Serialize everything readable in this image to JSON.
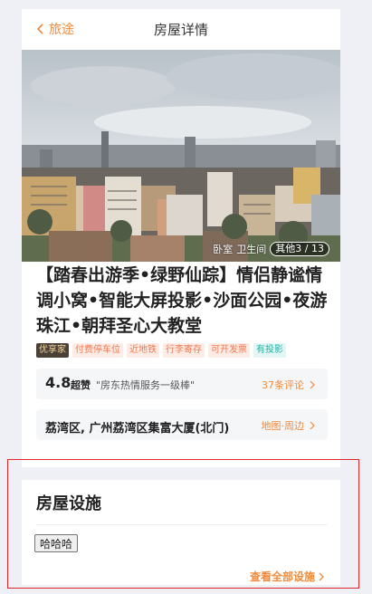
{
  "nav": {
    "back_label": "旅途",
    "title": "房屋详情"
  },
  "hero": {
    "tags": [
      "卧室",
      "卫生间"
    ],
    "counter": "其他3 / 13"
  },
  "listing": {
    "title": "【踏春出游季•绿野仙踪】情侣静谧情调小窝•智能大屏投影•沙面公园•夜游珠江•朝拜圣心大教堂",
    "tags": [
      {
        "label": "优享家",
        "style": "dark"
      },
      {
        "label": "付费停车位",
        "style": "orange"
      },
      {
        "label": "近地铁",
        "style": "orange"
      },
      {
        "label": "行李寄存",
        "style": "orange"
      },
      {
        "label": "可开发票",
        "style": "orange"
      },
      {
        "label": "有投影",
        "style": "teal"
      }
    ]
  },
  "review": {
    "score": "4.8",
    "score_word": "超赞",
    "quote": "\"房东热情服务一级棒\"",
    "link": "37条评论"
  },
  "location": {
    "address": "荔湾区, 广州荔湾区集富大厦(北门)",
    "link": "地图·周边"
  },
  "facilities": {
    "title": "房屋设施",
    "button": "哈哈哈",
    "all_link": "查看全部设施"
  },
  "colors": {
    "accent": "#f08a3c",
    "highlight_border": "#e0252a",
    "background": "#eef0f5"
  }
}
